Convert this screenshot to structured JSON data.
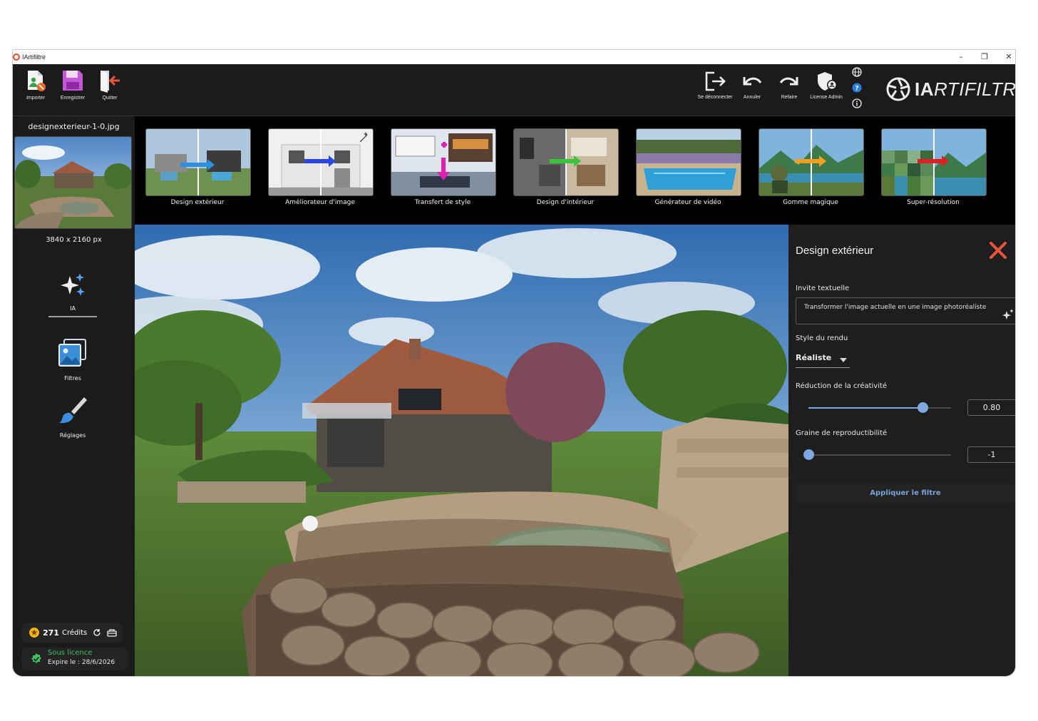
{
  "window": {
    "title": "IArtifiltre",
    "controls": [
      "–",
      "❐",
      "✕"
    ]
  },
  "toolbar": {
    "left": [
      {
        "id": "import",
        "label": "Importer",
        "icon": "import-icon"
      },
      {
        "id": "save",
        "label": "Enregistrer",
        "icon": "floppy-disk-icon"
      },
      {
        "id": "quit",
        "label": "Quitter",
        "icon": "exit-door-icon"
      }
    ],
    "right": [
      {
        "id": "logout",
        "label": "Se déconnecter",
        "icon": "logout-icon"
      },
      {
        "id": "undo",
        "label": "Annuler",
        "icon": "undo-icon"
      },
      {
        "id": "redo",
        "label": "Refaire",
        "icon": "redo-icon"
      },
      {
        "id": "license_admin",
        "label": "License Admin",
        "icon": "shield-user-icon"
      }
    ],
    "mini_icons": [
      "globe-icon",
      "help-icon",
      "info-icon"
    ],
    "brand": {
      "bold": "IA",
      "italic": "RTIFILTRE"
    }
  },
  "sidebar": {
    "file_name": "designexterieur-1-0.jpg",
    "dimensions": "3840 x 2160 px",
    "tools": [
      {
        "label": "IA",
        "icon": "sparkles-icon",
        "active": true
      },
      {
        "label": "Filtres",
        "icon": "images-icon",
        "active": false
      },
      {
        "label": "Réglages",
        "icon": "paintbrush-icon",
        "active": false
      }
    ],
    "credits": {
      "count": "271",
      "label": "Crédits"
    },
    "license": {
      "status": "Sous licence",
      "expires": "Expire le : 28/6/2026"
    }
  },
  "filters": [
    {
      "label": "Design extérieur",
      "arrow": "#2f8fe0"
    },
    {
      "label": "Améliorateur d'image",
      "arrow": "#2a46e0"
    },
    {
      "label": "Transfert de style",
      "arrow": "#e020b0"
    },
    {
      "label": "Design d'intérieur",
      "arrow": "#3cc43c"
    },
    {
      "label": "Générateur de vidéo",
      "arrow": ""
    },
    {
      "label": "Gomme magique",
      "arrow": "#f0a020"
    },
    {
      "label": "Super-résolution",
      "arrow": "#e02020"
    }
  ],
  "panel": {
    "title": "Design extérieur",
    "prompt_label": "Invite textuelle",
    "prompt_value": "Transformer l'image actuelle en une image photoréaliste",
    "style_label": "Style du rendu",
    "style_value": "Réaliste",
    "creativity_label": "Réduction de la créativité",
    "creativity_value": "0.80",
    "creativity_fraction": 0.8,
    "seed_label": "Graine de reproductibilité",
    "seed_value": "-1",
    "seed_fraction": 0.0,
    "apply_label": "Appliquer le filtre"
  },
  "colors": {
    "accent": "#7fa7e0",
    "close": "#e8553e",
    "license_ok": "#3fbf5f",
    "credits_coin": "#f2b01e"
  }
}
